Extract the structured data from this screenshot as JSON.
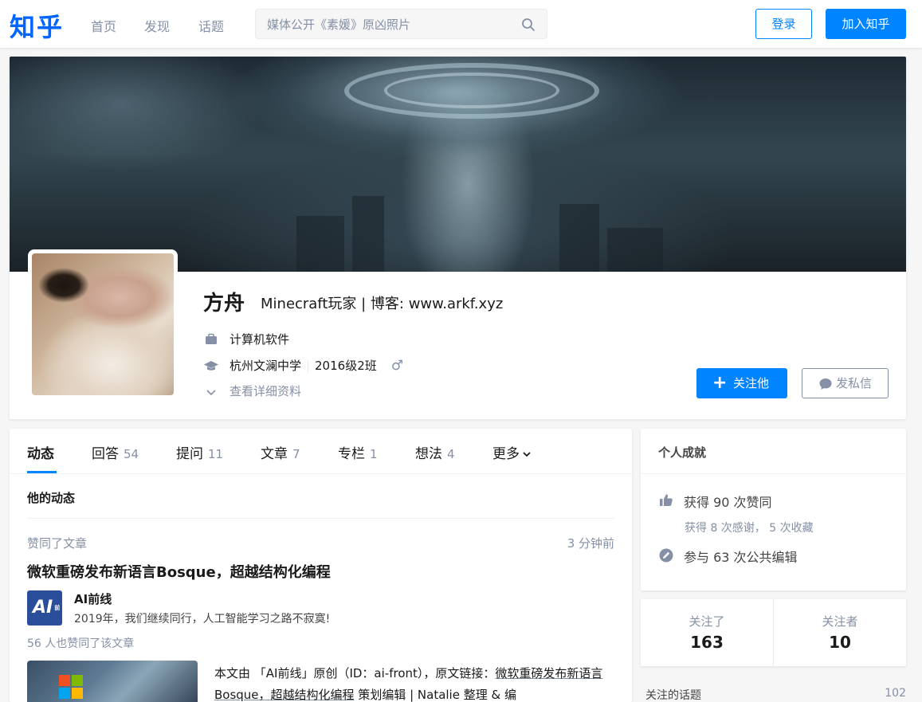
{
  "header": {
    "logo": "知乎",
    "nav": [
      "首页",
      "发现",
      "话题"
    ],
    "search_placeholder": "媒体公开《素媛》原凶照片",
    "login_label": "登录",
    "join_label": "加入知乎"
  },
  "profile": {
    "name": "方舟",
    "headline": "Minecraft玩家 | 博客: www.arkf.xyz",
    "industry": "计算机软件",
    "school": "杭州文澜中学",
    "class": "2016级2班",
    "gender_symbol": "♂",
    "detail_link": "查看详细资料",
    "follow_label": "关注他",
    "message_label": "发私信"
  },
  "tabs": [
    {
      "label": "动态",
      "count": ""
    },
    {
      "label": "回答",
      "count": "54"
    },
    {
      "label": "提问",
      "count": "11"
    },
    {
      "label": "文章",
      "count": "7"
    },
    {
      "label": "专栏",
      "count": "1"
    },
    {
      "label": "想法",
      "count": "4"
    },
    {
      "label": "更多",
      "count": ""
    }
  ],
  "feed": {
    "section_title": "他的动态",
    "action": "赞同了文章",
    "time": "3 分钟前",
    "article_title": "微软重磅发布新语言Bosque，超越结构化编程",
    "author_avatar_text": "AI",
    "author_avatar_small": "前线",
    "author_name": "AI前线",
    "author_bio": "2019年，我们继续同行，人工智能学习之路不寂寞!",
    "vote_count": "56 人也赞同了该文章",
    "excerpt_prefix": "本文由 「AI前线」原创（ID：ai-front），原文链接：",
    "excerpt_link": "微软重磅发布新语言Bosque，超越结构化编程",
    "excerpt_suffix": " 策划编辑 | Natalie 整理 & 编"
  },
  "achievements": {
    "title": "个人成就",
    "likes": "获得 90 次赞同",
    "thanks_favs": "获得 8 次感谢， 5 次收藏",
    "edits": "参与 63 次公共编辑"
  },
  "follow": {
    "following_label": "关注了",
    "following_count": "163",
    "followers_label": "关注者",
    "followers_count": "10"
  },
  "topics": {
    "label": "关注的话题",
    "count": "102"
  },
  "colors": {
    "brand": "#0084ff",
    "logo": "#0066ff",
    "muted": "#8590a6"
  }
}
